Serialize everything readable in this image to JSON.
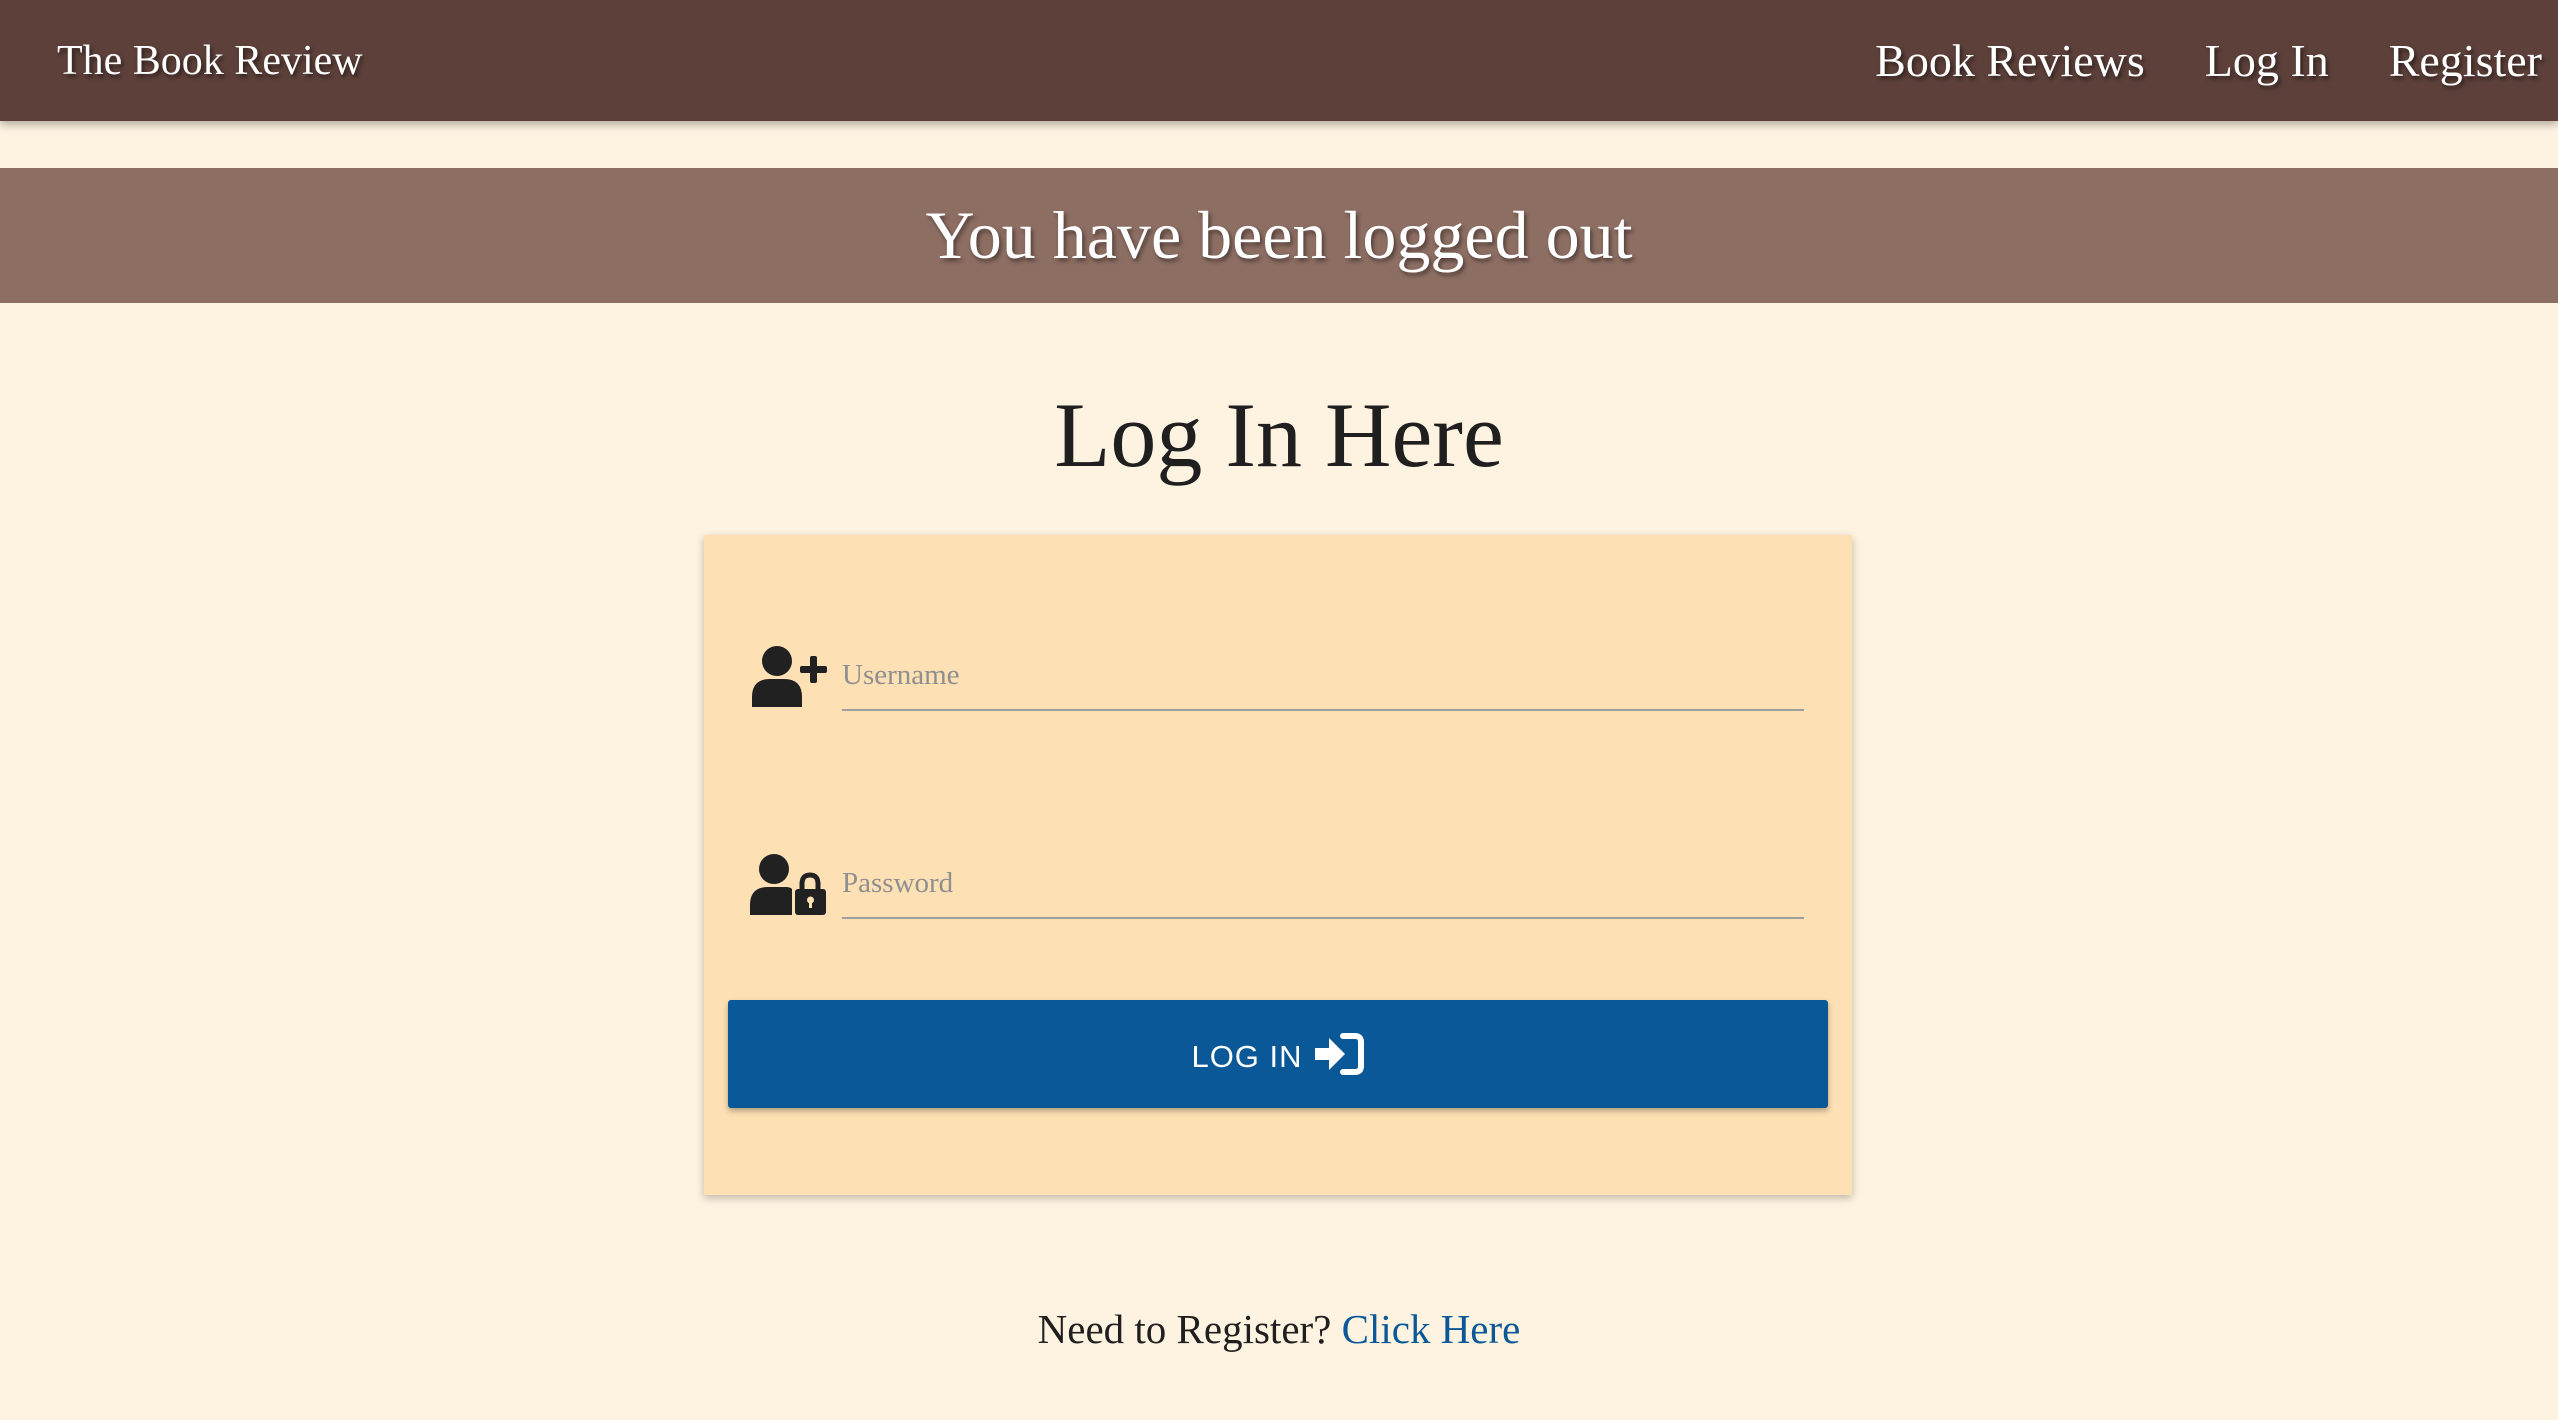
{
  "navbar": {
    "brand": "The Book Review",
    "links": [
      {
        "label": "Book Reviews"
      },
      {
        "label": "Log In"
      },
      {
        "label": "Register"
      }
    ]
  },
  "flash": {
    "message": "You have been logged out"
  },
  "page": {
    "title": "Log In Here"
  },
  "form": {
    "username": {
      "placeholder": "Username",
      "value": "",
      "icon": "user-plus-icon"
    },
    "password": {
      "placeholder": "Password",
      "value": "",
      "icon": "user-lock-icon"
    },
    "submit": {
      "label": "LOG IN",
      "icon": "sign-in-icon"
    }
  },
  "register": {
    "prompt": "Need to Register?",
    "link_label": "Click Here"
  },
  "colors": {
    "navbar": "#5d403a",
    "flash": "#8d6e63",
    "background": "#fef3e1",
    "card": "#fde0b3",
    "button": "#0b5898",
    "link": "#0b5898"
  }
}
